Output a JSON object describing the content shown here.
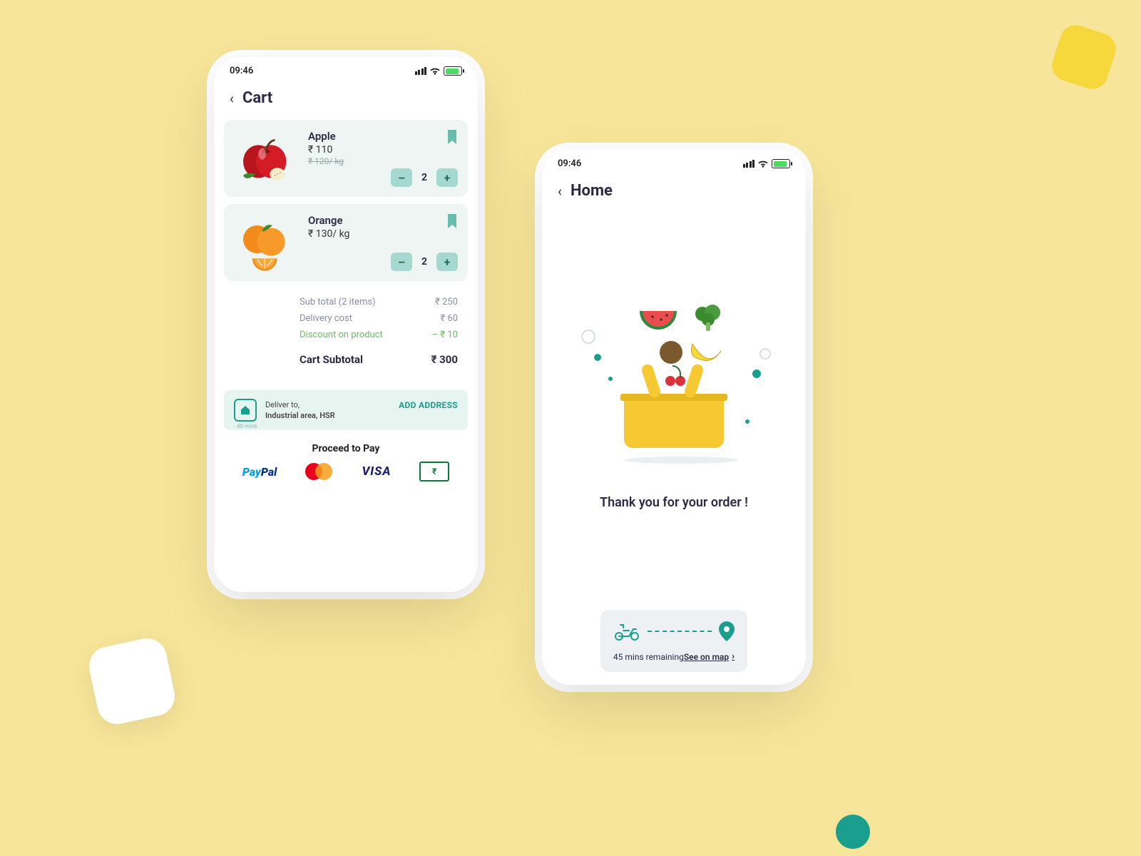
{
  "statusbar": {
    "time": "09:46"
  },
  "cart": {
    "title": "Cart",
    "items": [
      {
        "name": "Apple",
        "price": "₹ 110",
        "old": "₹ 120/ kg",
        "qty": "2"
      },
      {
        "name": "Orange",
        "price": "₹ 130/ kg",
        "old": "",
        "qty": "2"
      }
    ],
    "totals": {
      "subtotal_label": "Sub total (2 items)",
      "subtotal": "₹ 250",
      "delivery_label": "Delivery cost",
      "delivery": "₹ 60",
      "discount_label": "Discount on product",
      "discount": "– ₹ 10",
      "total_label": "Cart Subtotal",
      "total": "₹ 300"
    },
    "delivery": {
      "label": "Deliver to,",
      "address": "Industrial area, HSR",
      "eta": "40 mins",
      "add": "ADD ADDRESS"
    },
    "proceed": "Proceed to Pay",
    "pay": {
      "paypal": "PayPal",
      "visa": "VISA"
    }
  },
  "home": {
    "title": "Home",
    "thankyou": "Thank you for your order !",
    "remaining": "45 mins remaining",
    "see": "See on map"
  }
}
